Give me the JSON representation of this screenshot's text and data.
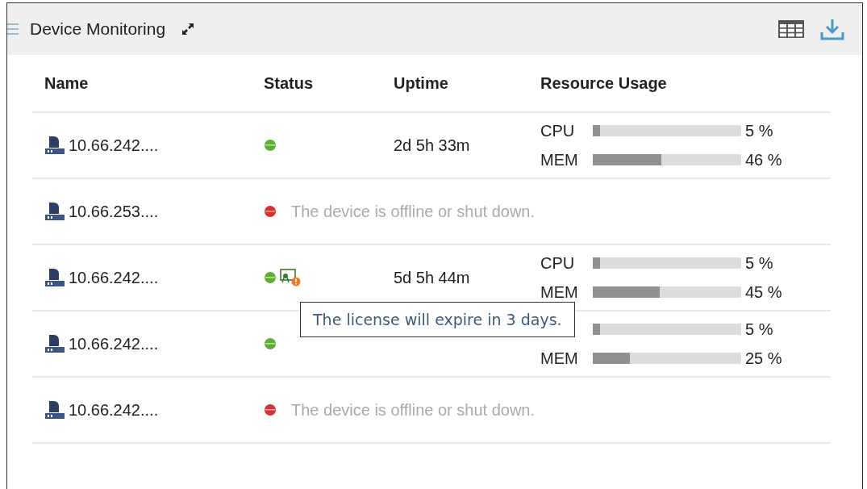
{
  "panel": {
    "title": "Device Monitoring"
  },
  "table": {
    "columns": [
      "Name",
      "Status",
      "Uptime",
      "Resource Usage"
    ],
    "rows": [
      {
        "name": "10.66.242....",
        "online": true,
        "license_warning": false,
        "uptime": "2d 5h 33m",
        "meters": [
          {
            "label": "CPU",
            "level": 0.05,
            "reading": "5 %"
          },
          {
            "label": "MEM",
            "level": 0.46,
            "reading": "46 %"
          }
        ]
      },
      {
        "name": "10.66.253....",
        "online": false,
        "license_warning": false,
        "message": "The device is offline or shut down."
      },
      {
        "name": "10.66.242....",
        "online": true,
        "license_warning": true,
        "uptime": "5d 5h 44m",
        "meters": [
          {
            "label": "CPU",
            "level": 0.05,
            "reading": "5 %"
          },
          {
            "label": "MEM",
            "level": 0.45,
            "reading": "45 %"
          }
        ],
        "tooltip": "The license will expire in 3 days."
      },
      {
        "name": "10.66.242....",
        "online": true,
        "license_warning": false,
        "meters": [
          {
            "level": 0.05,
            "reading": "5 %"
          },
          {
            "label": "MEM",
            "level": 0.25,
            "reading": "25 %"
          }
        ]
      },
      {
        "name": "10.66.242....",
        "online": false,
        "license_warning": false,
        "message": "The device is offline or shut down."
      }
    ]
  }
}
